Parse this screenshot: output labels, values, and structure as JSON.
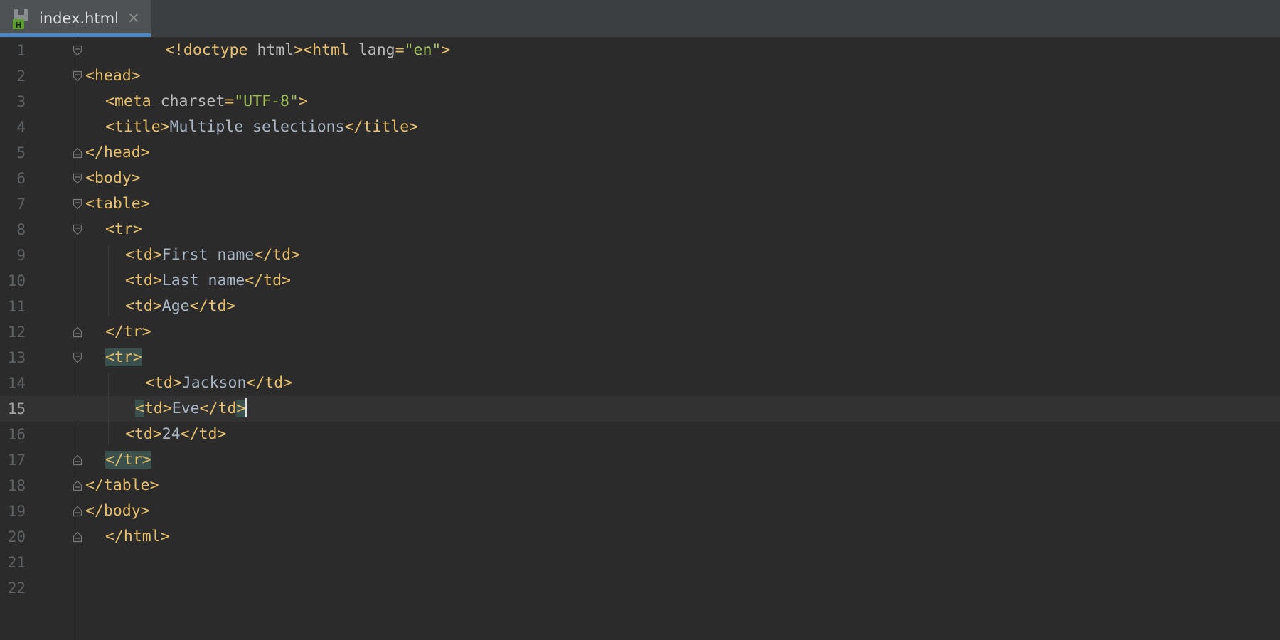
{
  "tab": {
    "filename": "index.html",
    "close_symbol": "×",
    "icon_badge": "H"
  },
  "editor": {
    "current_line": 15,
    "lines": [
      {
        "n": "1",
        "fold": "open",
        "indent": 4,
        "tokens": [
          [
            "tag",
            "<!doctype "
          ],
          [
            "attr",
            "html"
          ],
          [
            "tag",
            "><html "
          ],
          [
            "attr",
            "lang"
          ],
          [
            "tag",
            "="
          ],
          [
            "str",
            "\"en\""
          ],
          [
            "tag",
            ">"
          ]
        ]
      },
      {
        "n": "2",
        "fold": "open",
        "indent": 0,
        "tokens": [
          [
            "tag",
            "<head>"
          ]
        ]
      },
      {
        "n": "3",
        "fold": "",
        "indent": 1,
        "tokens": [
          [
            "tag",
            "<meta "
          ],
          [
            "attr",
            "charset"
          ],
          [
            "tag",
            "="
          ],
          [
            "str",
            "\"UTF-8\""
          ],
          [
            "tag",
            ">"
          ]
        ]
      },
      {
        "n": "4",
        "fold": "",
        "indent": 1,
        "tokens": [
          [
            "tag",
            "<title>"
          ],
          [
            "txt",
            "Multiple selections"
          ],
          [
            "tag",
            "</title>"
          ]
        ]
      },
      {
        "n": "5",
        "fold": "close",
        "indent": 0,
        "tokens": [
          [
            "tag",
            "</head>"
          ]
        ]
      },
      {
        "n": "6",
        "fold": "open",
        "indent": 0,
        "tokens": [
          [
            "tag",
            "<body>"
          ]
        ]
      },
      {
        "n": "7",
        "fold": "open",
        "indent": 0,
        "tokens": [
          [
            "tag",
            "<table>"
          ]
        ]
      },
      {
        "n": "8",
        "fold": "open",
        "indent": 1,
        "tokens": [
          [
            "tag",
            "<tr>"
          ]
        ]
      },
      {
        "n": "9",
        "fold": "",
        "indent": 2,
        "tokens": [
          [
            "tag",
            "<td>"
          ],
          [
            "txt",
            "First name"
          ],
          [
            "tag",
            "</td>"
          ]
        ]
      },
      {
        "n": "10",
        "fold": "",
        "indent": 2,
        "tokens": [
          [
            "tag",
            "<td>"
          ],
          [
            "txt",
            "Last name"
          ],
          [
            "tag",
            "</td>"
          ]
        ]
      },
      {
        "n": "11",
        "fold": "",
        "indent": 2,
        "tokens": [
          [
            "tag",
            "<td>"
          ],
          [
            "txt",
            "Age"
          ],
          [
            "tag",
            "</td>"
          ]
        ]
      },
      {
        "n": "12",
        "fold": "close",
        "indent": 1,
        "tokens": [
          [
            "tag",
            "</tr>"
          ]
        ]
      },
      {
        "n": "13",
        "fold": "open",
        "indent": 1,
        "tokens": [
          [
            "tag hl",
            "<tr>"
          ]
        ]
      },
      {
        "n": "14",
        "fold": "",
        "indent": 3,
        "tokens": [
          [
            "tag",
            "<td>"
          ],
          [
            "txt",
            "Jackson"
          ],
          [
            "tag",
            "</td>"
          ]
        ]
      },
      {
        "n": "15",
        "fold": "",
        "indent": 2.5,
        "tokens": [
          [
            "tag hl",
            "<"
          ],
          [
            "tag",
            "td>"
          ],
          [
            "txt",
            "Eve"
          ],
          [
            "tag",
            "</td"
          ],
          [
            "tag hl",
            ">"
          ],
          [
            "caret",
            ""
          ]
        ]
      },
      {
        "n": "16",
        "fold": "",
        "indent": 2,
        "tokens": [
          [
            "tag",
            "<td>"
          ],
          [
            "txt",
            "24"
          ],
          [
            "tag",
            "</td>"
          ]
        ]
      },
      {
        "n": "17",
        "fold": "close",
        "indent": 1,
        "tokens": [
          [
            "tag hl",
            "</tr>"
          ]
        ]
      },
      {
        "n": "18",
        "fold": "close",
        "indent": 0,
        "tokens": [
          [
            "tag",
            "</table>"
          ]
        ]
      },
      {
        "n": "19",
        "fold": "close",
        "indent": 0,
        "tokens": [
          [
            "tag",
            "</body>"
          ]
        ]
      },
      {
        "n": "20",
        "fold": "close",
        "indent": 1,
        "tokens": [
          [
            "tag",
            "</html>"
          ]
        ]
      },
      {
        "n": "21",
        "fold": "",
        "indent": 0,
        "tokens": []
      },
      {
        "n": "22",
        "fold": "",
        "indent": 0,
        "tokens": []
      }
    ]
  }
}
